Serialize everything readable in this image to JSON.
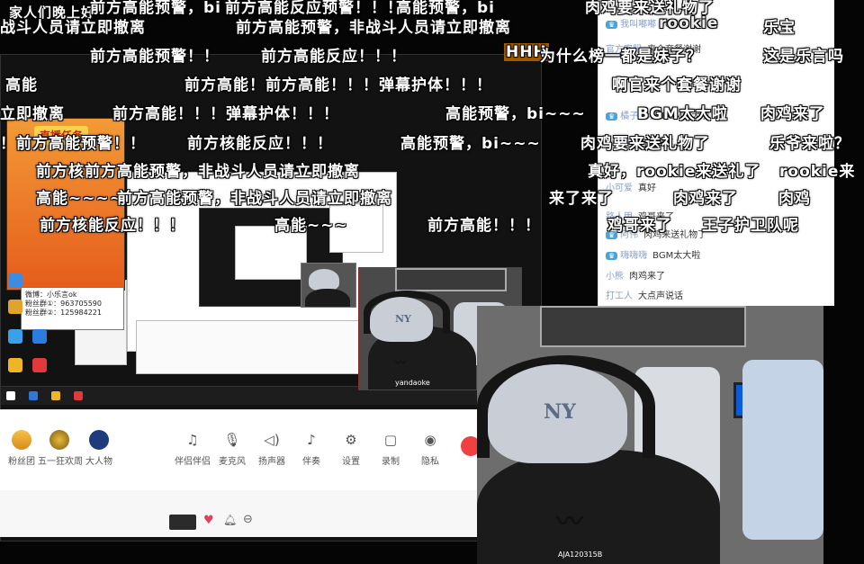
{
  "danmaku": [
    "家人们晚上好",
    "前方高能预警，bi",
    "前方高能反应预警！！！",
    "高能预警，bi",
    "肉鸡要来送礼物了",
    "前方高能预警，非战斗人员请立即撤离",
    "rookie",
    "乐宝",
    "前方高能预警！！",
    "前方高能反应！！！",
    "HHH",
    "为什么榜一都是妹子？",
    "这是乐言吗",
    "前方高能！前方高能！！！弹幕护体！！！",
    "啊官来个套餐谢谢",
    "立即撤离",
    "前方高能！！！弹幕护体！！！",
    "高能预警，bi~~~",
    "BGM太大啦",
    "肉鸡来了",
    "！前方高能预警！！",
    "前方核能反应！！！",
    "高能预警，bi~~~",
    "肉鸡要来送礼物了",
    "乐爷来啦？",
    "前方核前方高能预警，非战斗人员请立即撤离",
    "真好，rookie来送礼了",
    "rookie来",
    "高能~~~~",
    "前方高能预警，非战斗人员请立即撤离",
    "来了来了",
    "肉鸡来了",
    "肉鸡",
    "前方核能反应！！！",
    "高能~~~",
    "前方高能！！！",
    "鸡哥来了",
    "王子护卫队呢"
  ],
  "chat": {
    "rows": [
      {
        "user": "我叫嘟嘟",
        "text": "rookie"
      },
      {
        "user": "官方客服",
        "text": "来个套餐谢谢"
      },
      {
        "user": "橘子汽水",
        "text": "BGM太大啦"
      },
      {
        "user": "小鱼干",
        "text": "肉鸡来了"
      },
      {
        "user": "小可爱",
        "text": "真好"
      },
      {
        "user": "路人甲",
        "text": "鸡哥来了"
      },
      {
        "user": "阿伟",
        "text": "肉鸡来送礼物了"
      },
      {
        "user": "嗨嗨嗨",
        "text": "BGM太大啦"
      },
      {
        "user": "小熊",
        "text": "肉鸡来了"
      },
      {
        "user": "打工人",
        "text": "大点声说话"
      }
    ]
  },
  "promo": {
    "title": "直播任务"
  },
  "qr_card": {
    "line1": "微博：小乐言ok",
    "line2": "粉丝群①：963705590",
    "line3": "粉丝群②：125984221"
  },
  "toolbar": {
    "items": [
      {
        "label": "粉丝团",
        "icon": "fan-club-icon"
      },
      {
        "label": "五一狂欢周",
        "icon": "event-icon"
      },
      {
        "label": "大人物",
        "icon": "vip-icon"
      },
      {
        "label": "伴侣伴侣",
        "icon": "companion-icon"
      },
      {
        "label": "麦克风",
        "icon": "mic-icon"
      },
      {
        "label": "扬声器",
        "icon": "speaker-icon"
      },
      {
        "label": "伴奏",
        "icon": "music-icon"
      },
      {
        "label": "设置",
        "icon": "gear-icon"
      },
      {
        "label": "录制",
        "icon": "record-icon"
      },
      {
        "label": "隐私",
        "icon": "eye-icon"
      }
    ]
  },
  "cam": {
    "caption_main": "AJA120315B",
    "caption_small": "yandaoke"
  },
  "colors": {
    "danmaku_text": "#ffffff",
    "chat_bg": "#ffffff",
    "accent_red": "#f23f3f"
  }
}
